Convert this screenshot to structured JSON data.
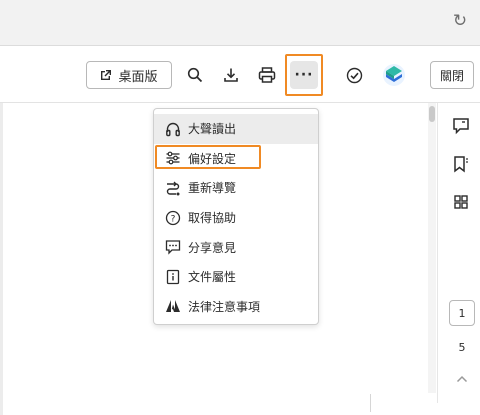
{
  "browser": {
    "reload_icon": "reload-icon"
  },
  "toolbar": {
    "desktop_label": "桌面版",
    "close_label": "關閉",
    "icons": [
      "external-link-icon",
      "search-icon",
      "download-icon",
      "print-icon",
      "more-icon",
      "check-circle-icon",
      "avatar-icon"
    ],
    "more_glyph": "···",
    "highlight_color": "#f08a24"
  },
  "menu": {
    "items": [
      {
        "label": "大聲讀出",
        "icon": "headphones-icon"
      },
      {
        "label": "偏好設定",
        "icon": "sliders-icon"
      },
      {
        "label": "重新導覽",
        "icon": "route-icon"
      },
      {
        "label": "取得協助",
        "icon": "help-icon"
      },
      {
        "label": "分享意見",
        "icon": "feedback-icon"
      },
      {
        "label": "文件屬性",
        "icon": "info-icon"
      },
      {
        "label": "法律注意事項",
        "icon": "adobe-logo-icon"
      }
    ]
  },
  "rail": {
    "icons": [
      "comment-icon",
      "bookmark-icon",
      "thumbnails-icon",
      "chevron-up-icon"
    ],
    "current_page": "1",
    "total_pages": "5"
  }
}
